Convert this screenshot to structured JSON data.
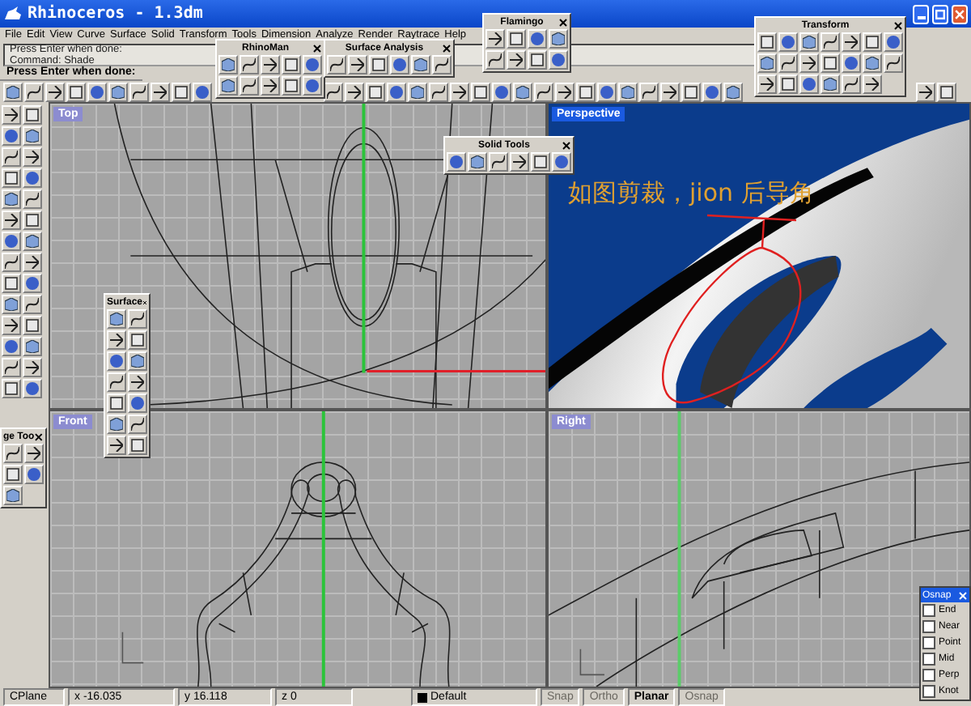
{
  "window": {
    "title": "Rhinoceros - 1.3dm"
  },
  "menu": [
    "File",
    "Edit",
    "View",
    "Curve",
    "Surface",
    "Solid",
    "Transform",
    "Tools",
    "Dimension",
    "Analyze",
    "Render",
    "Raytrace",
    "Help"
  ],
  "command_history": [
    "Press Enter when done:",
    "Command: Shade"
  ],
  "command_prompt": "Press Enter when done:",
  "viewports": [
    {
      "label": "Top",
      "selected": false
    },
    {
      "label": "Perspective",
      "selected": true
    },
    {
      "label": "Front",
      "selected": false
    },
    {
      "label": "Right",
      "selected": false
    }
  ],
  "annotation": "如图剪裁，jion 后导角",
  "floating_toolbars": [
    {
      "title": "RhinoMan"
    },
    {
      "title": "Surface Analysis"
    },
    {
      "title": "Flamingo"
    },
    {
      "title": "Transform"
    },
    {
      "title": "Solid Tools"
    },
    {
      "title": "Surface"
    },
    {
      "title": "ge Too"
    }
  ],
  "osnap": {
    "title": "Osnap",
    "items": [
      {
        "label": "End",
        "checked": false
      },
      {
        "label": "Near",
        "checked": false
      },
      {
        "label": "Point",
        "checked": false
      },
      {
        "label": "Mid",
        "checked": false
      },
      {
        "label": "Perp",
        "checked": false
      },
      {
        "label": "Knot",
        "checked": false
      }
    ]
  },
  "status_bar": {
    "fields": [
      "CPlane",
      "x -16.035",
      "y 16.118",
      "z 0"
    ],
    "layer": "Default",
    "toggles": [
      {
        "label": "Snap",
        "on": false
      },
      {
        "label": "Ortho",
        "on": false
      },
      {
        "label": "Planar",
        "on": true
      },
      {
        "label": "Osnap",
        "on": false
      }
    ]
  }
}
